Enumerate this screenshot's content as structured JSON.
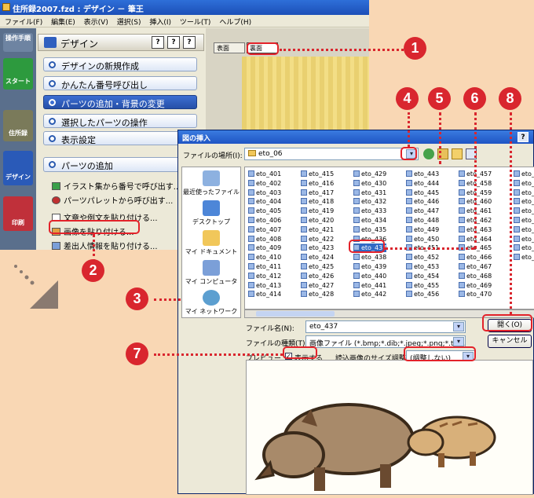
{
  "app": {
    "title": "住所録2007.fzd : デザイン － 筆王",
    "menu": [
      "ファイル(F)",
      "編集(E)",
      "表示(V)",
      "選択(S)",
      "挿入(I)",
      "ツール(T)",
      "ヘルプ(H)"
    ],
    "side_tabs": [
      "操作手順",
      "スタート",
      "住所録",
      "デザイン",
      "印刷"
    ],
    "panel_title": "デザイン",
    "help_buttons": [
      "?",
      "?",
      "?"
    ],
    "nav": [
      "デザインの新規作成",
      "かんたん番号呼び出し",
      "パーツの追加・背景の変更",
      "選択したパーツの操作",
      "表示設定"
    ],
    "sub_title": "パーツの追加",
    "sub_items": [
      "イラスト集から番号で呼び出す...",
      "パーツパレットから呼び出す...",
      "文章や例文を貼り付ける...",
      "画像を貼り付ける...",
      "差出人情報を貼り付ける..."
    ],
    "view_tabs": [
      "表面",
      "裏面"
    ]
  },
  "dialog": {
    "title": "図の挿入",
    "help": "?",
    "close": "X",
    "location_label": "ファイルの場所(I):",
    "location_value": "eto_06",
    "places": [
      "最近使ったファイル",
      "デスクトップ",
      "マイ ドキュメント",
      "マイ コンピュータ",
      "マイ ネットワーク"
    ],
    "file_columns": [
      [
        "eto_401",
        "eto_402",
        "eto_403",
        "eto_404",
        "eto_405",
        "eto_406",
        "eto_407",
        "eto_408",
        "eto_409",
        "eto_410",
        "eto_411",
        "eto_412",
        "eto_413",
        "eto_414"
      ],
      [
        "eto_415",
        "eto_416",
        "eto_417",
        "eto_418",
        "eto_419",
        "eto_420",
        "eto_421",
        "eto_422",
        "eto_423",
        "eto_424",
        "eto_425",
        "eto_426",
        "eto_427",
        "eto_428"
      ],
      [
        "eto_429",
        "eto_430",
        "eto_431",
        "eto_432",
        "eto_433",
        "eto_434",
        "eto_435",
        "eto_436",
        "eto_437",
        "eto_438",
        "eto_439",
        "eto_440",
        "eto_441",
        "eto_442"
      ],
      [
        "eto_443",
        "eto_444",
        "eto_445",
        "eto_446",
        "eto_447",
        "eto_448",
        "eto_449",
        "eto_450",
        "eto_451",
        "eto_452",
        "eto_453",
        "eto_454",
        "eto_455",
        "eto_456"
      ],
      [
        "eto_457",
        "eto_458",
        "eto_459",
        "eto_460",
        "eto_461",
        "eto_462",
        "eto_463",
        "eto_464",
        "eto_465",
        "eto_466",
        "eto_467",
        "eto_468",
        "eto_469",
        "eto_470"
      ],
      [
        "eto_",
        "eto_",
        "eto_",
        "eto_",
        "eto_",
        "eto_",
        "eto_",
        "eto_",
        "eto_",
        "eto_"
      ]
    ],
    "selected_file": "eto_437",
    "filename_label": "ファイル名(N):",
    "filename_value": "eto_437",
    "filetype_label": "ファイルの種類(T):",
    "filetype_value": "画像ファイル (*.bmp;*.dib;*.jpeg;*.png;*.tif;*.exif;*.psd;*.fp",
    "open_button": "開く(O)",
    "cancel_button": "キャンセル",
    "preview_label": "プレビュー",
    "preview_checkbox": "表示する",
    "resize_label": "読込画像のサイズ調整:",
    "resize_value": "(調整しない)"
  },
  "callouts": [
    "1",
    "2",
    "3",
    "4",
    "5",
    "6",
    "7",
    "8"
  ],
  "colors": {
    "callout": "#d9262e",
    "title_blue": "#1f55c4",
    "background": "#f9d7b4"
  }
}
